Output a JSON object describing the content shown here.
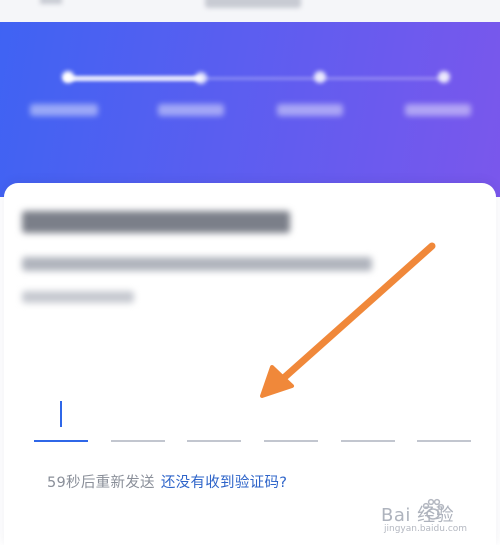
{
  "header": {
    "title": "",
    "back_icon": "chevron-left-icon"
  },
  "steps": {
    "active_index": 0,
    "count": 4,
    "progress_fraction": 0.33,
    "labels": [
      "",
      "",
      "",
      ""
    ]
  },
  "card": {
    "heading": "",
    "description": "",
    "phone": ""
  },
  "code_input": {
    "length": 6,
    "filled": 0
  },
  "resend": {
    "countdown": "59秒后重新发送",
    "help_link": "还没有收到验证码?"
  },
  "colors": {
    "hero_start": "#3f63f3",
    "hero_end": "#7a57ec",
    "link": "#2e64c9",
    "annotation_arrow": "#f0883a"
  },
  "annotation": {
    "icon": "arrow-pointer-icon"
  },
  "watermark": {
    "brand_text": "Bai 经验",
    "domain": "jingyan.baidu.com",
    "icon": "paw-icon"
  }
}
